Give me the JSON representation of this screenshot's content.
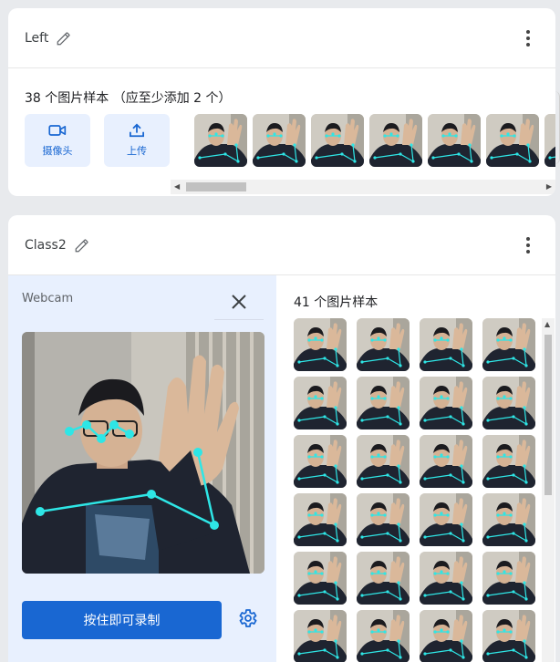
{
  "class1": {
    "title": "Left",
    "samples_label": "38 个图片样本 （应至少添加 2 个）",
    "webcam_label": "摄像头",
    "upload_label": "上传",
    "thumbnail_count": 7
  },
  "class2": {
    "title": "Class2",
    "webcam_label": "Webcam",
    "samples_label": "41 个图片样本",
    "record_label": "按住即可录制",
    "thumbnail_count": 24
  },
  "colors": {
    "accent": "#1967d2",
    "accent_light": "#e8f0fe",
    "pose": "#2ee6e6",
    "background": "#e8eaed"
  },
  "icons": [
    "pencil-icon",
    "more-vert-icon",
    "videocam-icon",
    "upload-icon",
    "close-icon",
    "settings-icon"
  ]
}
